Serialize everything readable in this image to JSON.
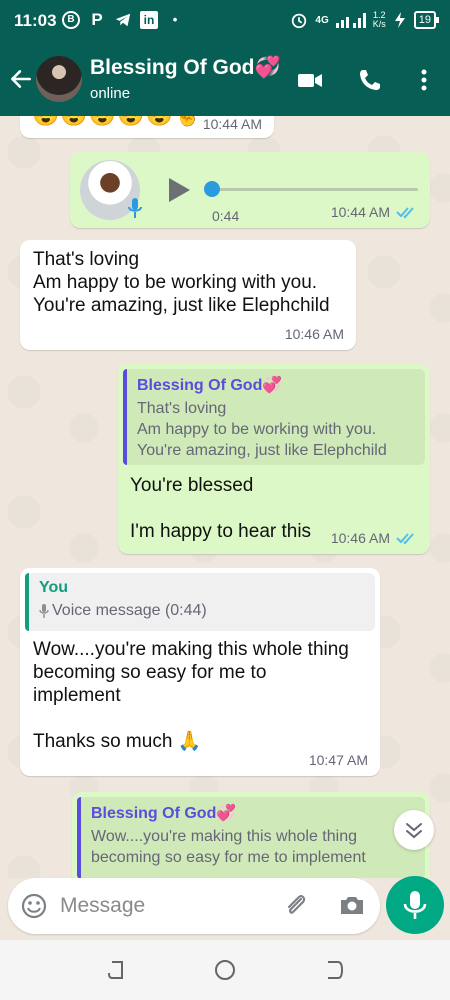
{
  "status_bar": {
    "time": "11:03",
    "net_speed_top": "1.2",
    "net_speed_bottom": "K/s",
    "net_type": "4G",
    "battery": "19"
  },
  "header": {
    "contact_name": "Blessing Of God💞",
    "contact_status": "online"
  },
  "messages": {
    "m0": {
      "time": "10:44 AM",
      "emojis": "😍😍😍😍😍🤞"
    },
    "m1": {
      "duration": "0:44",
      "time": "10:44 AM"
    },
    "m2": {
      "text": "That's loving\nAm happy to be working with you.\nYou're amazing, just like Elephchild",
      "time": "10:46 AM"
    },
    "m3": {
      "quote_author": "Blessing Of God💞",
      "quote_text": "That's loving\nAm happy to be working with you.\nYou're amazing, just like Elephchild",
      "text": "You're blessed\n\nI'm happy to hear this",
      "time": "10:46 AM"
    },
    "m4": {
      "quote_author": "You",
      "quote_text": "Voice message (0:44)",
      "text": "Wow....you're making this whole thing\nbecoming so easy for me to\nimplement\n\nThanks so much 🙏",
      "time": "10:47 AM"
    },
    "m5": {
      "quote_author": "Blessing Of God💞",
      "quote_text": "Wow....you're making this whole thing\nbecoming so easy for me to implement"
    }
  },
  "input": {
    "placeholder": "Message"
  },
  "colors": {
    "header": "#075e54",
    "outgoing": "#dcf8c6",
    "incoming": "#ffffff",
    "accent": "#00a884",
    "read_ticks": "#53bdeb"
  }
}
